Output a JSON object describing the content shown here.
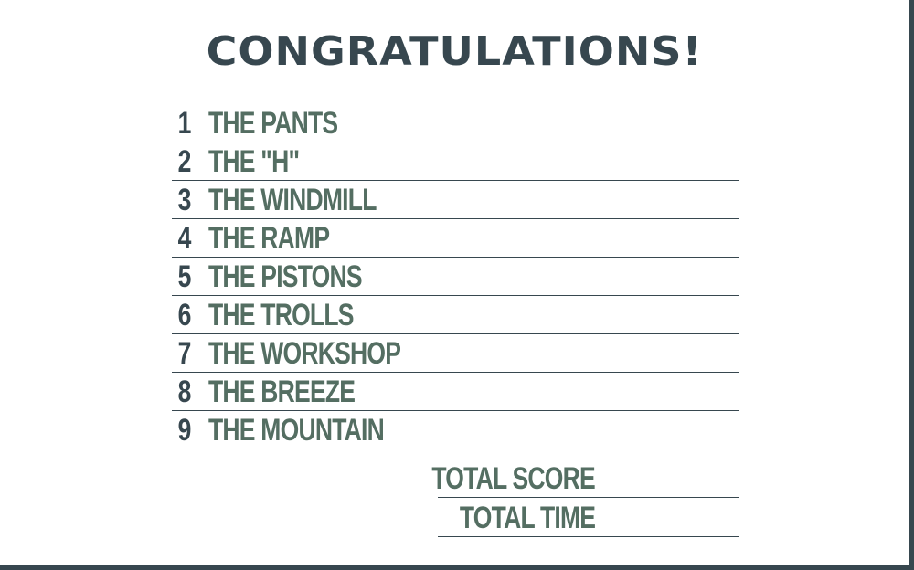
{
  "title": "CONGRATULATIONS!",
  "holes": [
    {
      "number": "1",
      "name": "THE PANTS"
    },
    {
      "number": "2",
      "name": "THE \"H\""
    },
    {
      "number": "3",
      "name": "THE WINDMILL"
    },
    {
      "number": "4",
      "name": "THE RAMP"
    },
    {
      "number": "5",
      "name": "THE PISTONS"
    },
    {
      "number": "6",
      "name": "THE TROLLS"
    },
    {
      "number": "7",
      "name": "THE WORKSHOP"
    },
    {
      "number": "8",
      "name": "THE BREEZE"
    },
    {
      "number": "9",
      "name": "THE MOUNTAIN"
    }
  ],
  "totals": {
    "score_label": "TOTAL SCORE",
    "time_label": "TOTAL TIME"
  },
  "colors": {
    "frame": "#37474f",
    "number_text": "#37474f",
    "hole_text": "#546e62"
  }
}
